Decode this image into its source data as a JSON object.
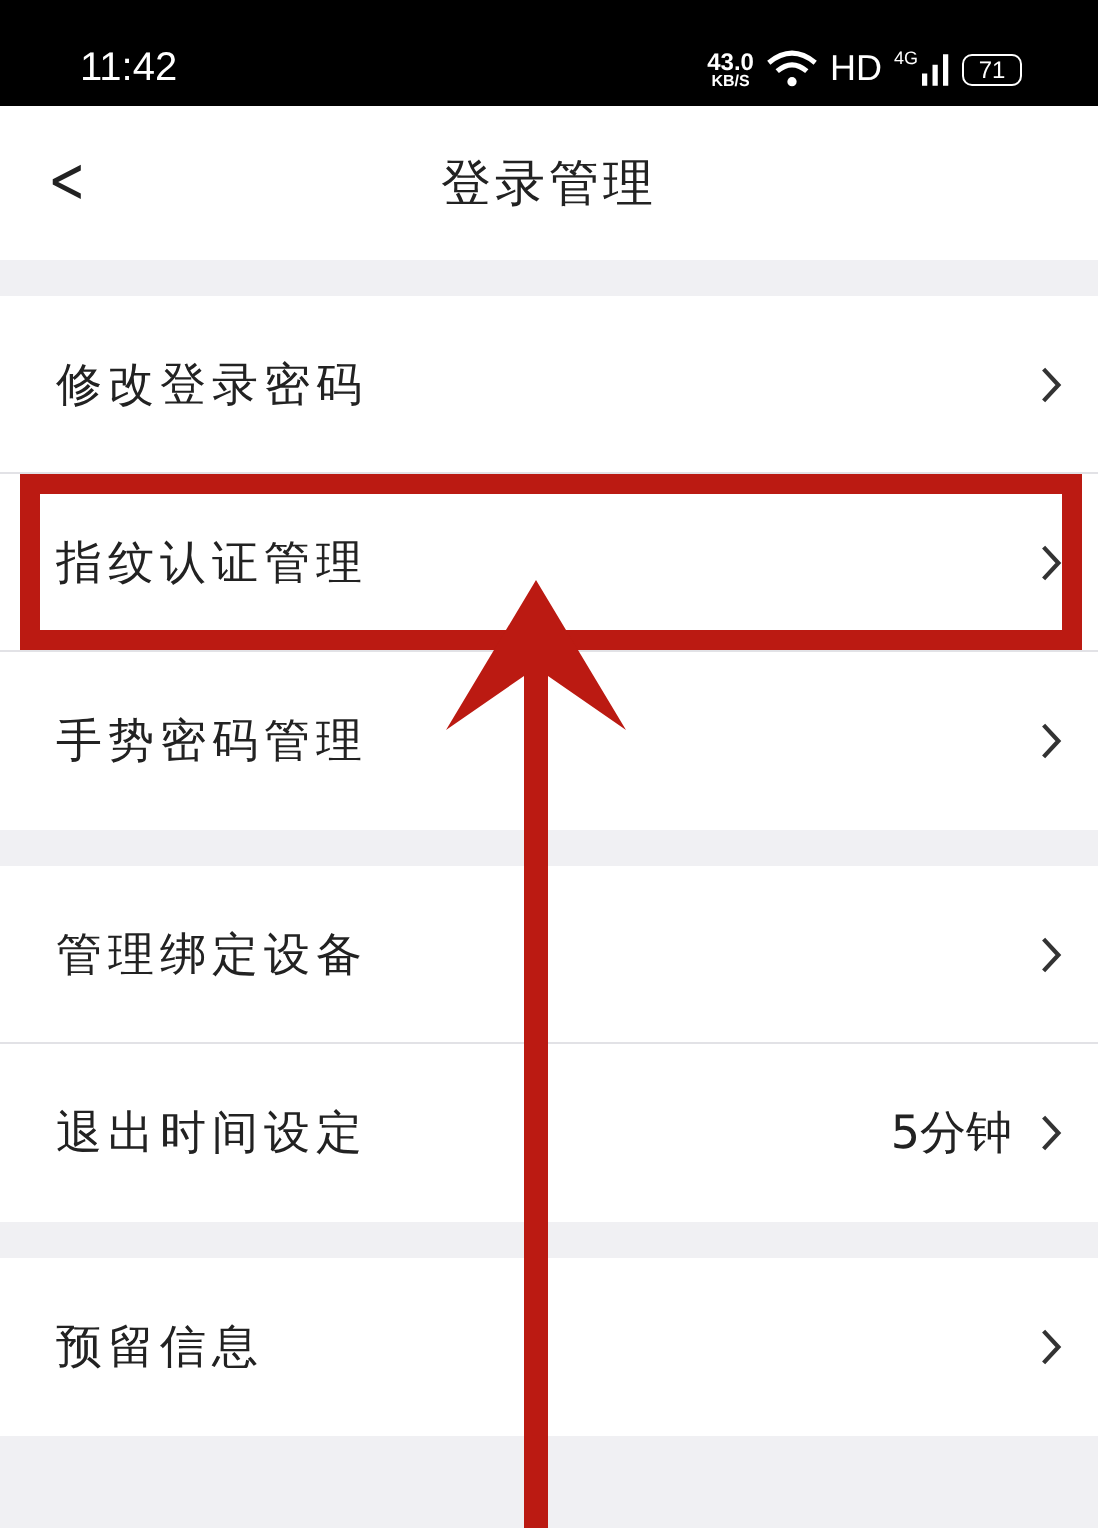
{
  "status_bar": {
    "time": "11:42",
    "speed": "43.0",
    "speed_unit": "KB/S",
    "hd": "HD",
    "network": "4G",
    "battery": "71"
  },
  "nav": {
    "back": "<",
    "title": "登录管理"
  },
  "sections": [
    {
      "rows": [
        {
          "label": "修改登录密码",
          "highlighted": false
        },
        {
          "label": "指纹认证管理",
          "highlighted": true
        },
        {
          "label": "手势密码管理",
          "highlighted": false
        }
      ]
    },
    {
      "rows": [
        {
          "label": "管理绑定设备",
          "highlighted": false
        },
        {
          "label": "退出时间设定",
          "value": "5分钟",
          "highlighted": false
        }
      ]
    },
    {
      "rows": [
        {
          "label": "预留信息",
          "highlighted": false
        }
      ]
    }
  ]
}
